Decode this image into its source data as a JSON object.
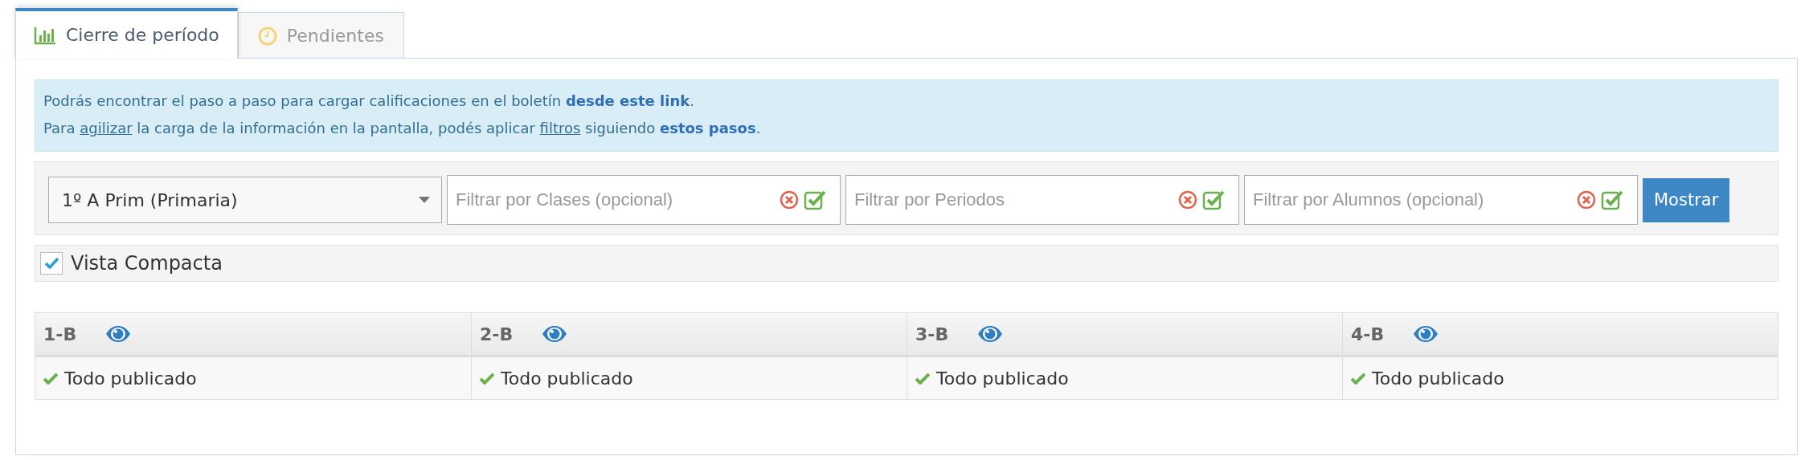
{
  "tabs": [
    {
      "label": "Cierre de período",
      "kind": "chart",
      "selected": true
    },
    {
      "label": "Pendientes",
      "kind": "clock",
      "selected": false
    }
  ],
  "info": [
    [
      {
        "kind": "text",
        "text": "Podrás encontrar el paso a paso para cargar calificaciones en el boletín "
      },
      {
        "kind": "link",
        "text": "desde este link"
      },
      {
        "kind": "text",
        "text": "."
      }
    ],
    [
      {
        "kind": "text",
        "text": "Para "
      },
      {
        "kind": "underline",
        "text": "agilizar"
      },
      {
        "kind": "text",
        "text": " la carga de la información en la pantalla, podés aplicar "
      },
      {
        "kind": "underline",
        "text": "filtros"
      },
      {
        "kind": "text",
        "text": " siguiendo "
      },
      {
        "kind": "link",
        "text": "estos pasos"
      },
      {
        "kind": "text",
        "text": "."
      }
    ]
  ],
  "filters": {
    "select": {
      "value": "1º A Prim (Primaria)"
    },
    "fields": [
      {
        "placeholder": "Filtrar por Clases (opcional)"
      },
      {
        "placeholder": "Filtrar por Periodos"
      },
      {
        "placeholder": "Filtrar por Alumnos (opcional)"
      }
    ],
    "button": "Mostrar"
  },
  "compact": {
    "label": "Vista Compacta",
    "checked": true
  },
  "table": {
    "columns": [
      {
        "label": "1-B",
        "status": "Todo publicado"
      },
      {
        "label": "2-B",
        "status": "Todo publicado"
      },
      {
        "label": "3-B",
        "status": "Todo publicado"
      },
      {
        "label": "4-B",
        "status": "Todo publicado"
      }
    ]
  }
}
